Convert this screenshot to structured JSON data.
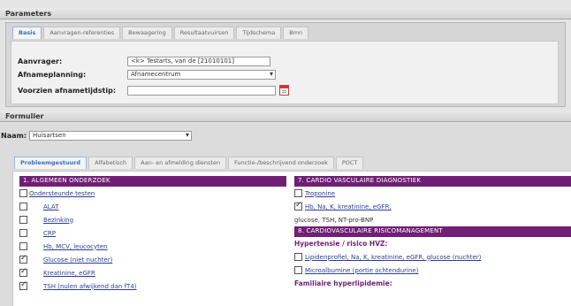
{
  "parameters": {
    "title": "Parameters",
    "tabs": [
      {
        "label": "Basis",
        "active": true
      },
      {
        "label": "Aanvragen-referenties",
        "active": false
      },
      {
        "label": "Bewaagering",
        "active": false
      },
      {
        "label": "Resultaatvuirsen",
        "active": false
      },
      {
        "label": "Tijdschema",
        "active": false
      },
      {
        "label": "Bmn",
        "active": false
      }
    ],
    "fields": {
      "aanvrager": {
        "label": "Aanvrager:",
        "value": "<k> Testarts, van de [21010101]"
      },
      "afnameplanning": {
        "label": "Afnameplanning:",
        "value": "Afnamecentrum"
      },
      "voorzien": {
        "label": "Voorzien afnametijdstip:",
        "value": ""
      }
    }
  },
  "formulier": {
    "title": "Formulier",
    "naam_label": "Naam:",
    "naam_value": "Huisartsen",
    "tabs": [
      {
        "label": "Probleemgestuurd",
        "active": true
      },
      {
        "label": "Alfabetisch",
        "active": false
      },
      {
        "label": "Aan- en afmelding diensten",
        "active": false
      },
      {
        "label": "Functie-/beschrijvend onderzoek",
        "active": false
      },
      {
        "label": "POCT",
        "active": false
      }
    ],
    "left": {
      "section": "1. ALGEMEEN ONDERZOEK",
      "items": [
        {
          "label": "Ondersteunde testen",
          "checked": false
        },
        {
          "label": "ALAT",
          "checked": false
        },
        {
          "label": "Bezinking",
          "checked": false
        },
        {
          "label": "CRP",
          "checked": false
        },
        {
          "label": "Hb, MCV, leucocyten",
          "checked": false
        },
        {
          "label": "Glucose (niet nuchter)",
          "checked": true
        },
        {
          "label": "Kreatinine, eGFR",
          "checked": true
        },
        {
          "label": "TSH (nulen afwijkend dan fT4)",
          "checked": true
        }
      ]
    },
    "right": {
      "section1": "7. CARDIO VASCULAIRE DIAGNOSTIEK",
      "items1": [
        {
          "label": "Troponine",
          "checked": false
        },
        {
          "label": "Hb, Na, K, kreatinine, eGFR,",
          "checked": true
        }
      ],
      "plain_line": "glucose, TSH, NT-pro-BNP",
      "section2": "8. CARDIOVASCULAIRE RISICOMANAGEMENT",
      "sub1": "Hypertensie / risico HVZ:",
      "items2": [
        {
          "label": "Lipidenprofiel, Na, K, kreatinine, eGFR, glucose (nuchter)",
          "checked": false
        },
        {
          "label": "Microalbumine (portie ochtendurine)",
          "checked": false
        }
      ],
      "sub2": "Familiaire hyperlipidemie:"
    }
  }
}
